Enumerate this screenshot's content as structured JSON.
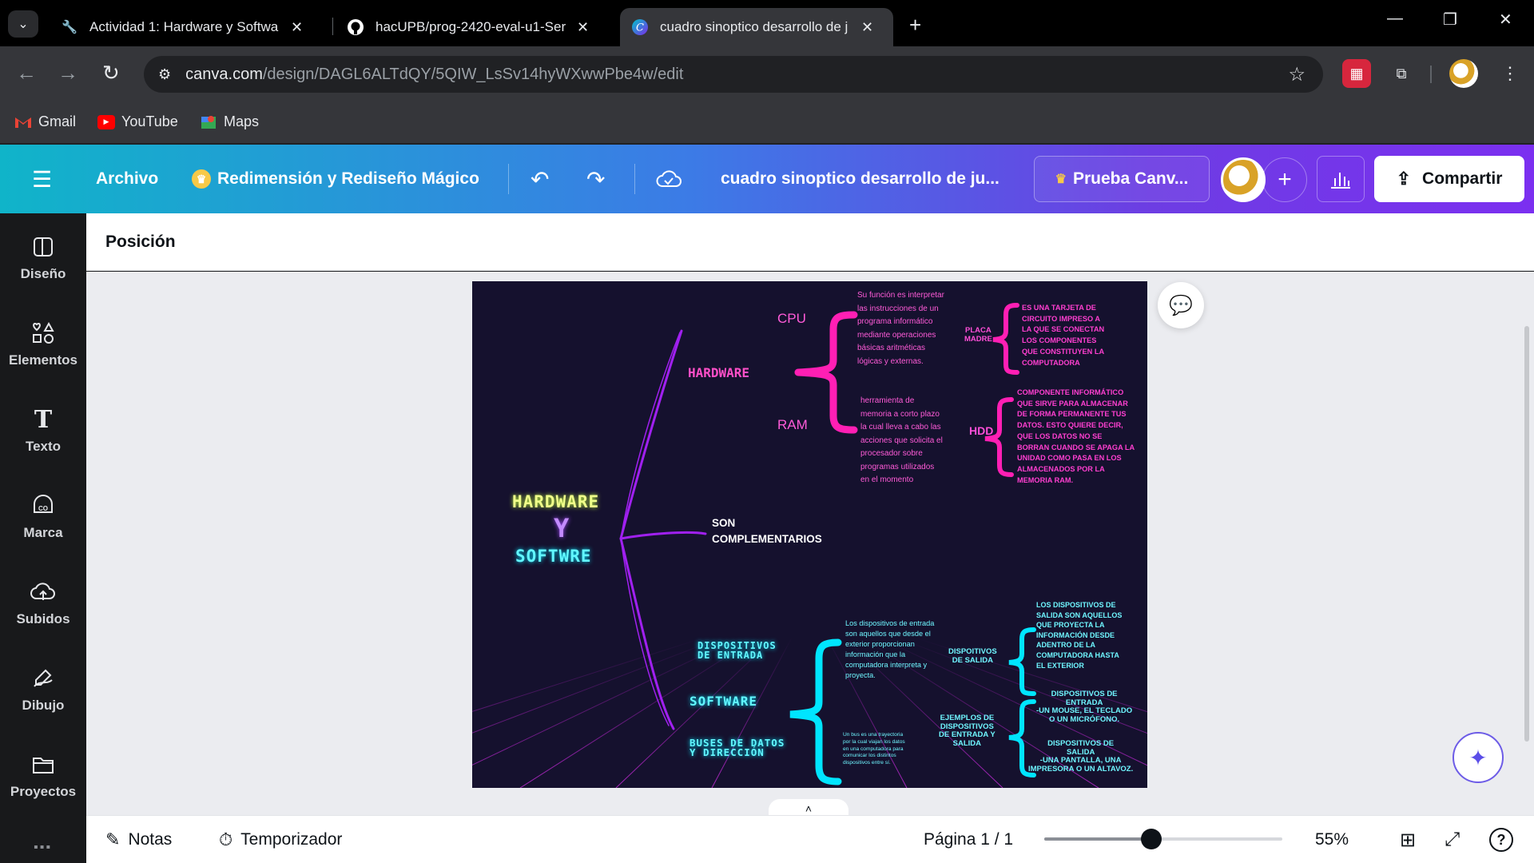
{
  "browser": {
    "tabs": [
      {
        "title": "Actividad 1: Hardware y Softwa",
        "favicon": "wrench-icon"
      },
      {
        "title": "hacUPB/prog-2420-eval-u1-Ser",
        "favicon": "github-icon"
      },
      {
        "title": "cuadro sinoptico desarrollo de j",
        "favicon": "canva-icon",
        "active": true
      }
    ],
    "url_host": "canva.com",
    "url_path": "/design/DAGL6ALTdQY/5QIW_LsSv14hyWXwwPbe4w/edit",
    "bookmarks": [
      {
        "label": "Gmail",
        "icon": "gmail-icon"
      },
      {
        "label": "YouTube",
        "icon": "youtube-icon"
      },
      {
        "label": "Maps",
        "icon": "maps-icon"
      }
    ]
  },
  "canva": {
    "header": {
      "archivo": "Archivo",
      "magic_resize": "Redimensión y Rediseño Mágico",
      "doc_title": "cuadro sinoptico desarrollo de ju...",
      "trial": "Prueba Canv...",
      "share": "Compartir"
    },
    "sidebar": [
      {
        "label": "Diseño",
        "icon": "layout-icon"
      },
      {
        "label": "Elementos",
        "icon": "shapes-icon"
      },
      {
        "label": "Texto",
        "icon": "text-icon"
      },
      {
        "label": "Marca",
        "icon": "brand-icon"
      },
      {
        "label": "Subidos",
        "icon": "cloud-upload-icon"
      },
      {
        "label": "Dibujo",
        "icon": "draw-icon"
      },
      {
        "label": "Proyectos",
        "icon": "folder-icon"
      }
    ],
    "context_bar": {
      "position_label": "Posición"
    },
    "footer": {
      "notes": "Notas",
      "timer": "Temporizador",
      "page": "Página 1 / 1",
      "zoom": "55%",
      "zoom_fraction": 0.55
    }
  },
  "design": {
    "title_line1": "HARDWARE",
    "title_line2": "Y",
    "title_line3": "SOFTWRE",
    "hardware": "HARDWARE",
    "cpu": "CPU",
    "ram": "RAM",
    "cpu_desc": "Su función es interpretar\nlas instrucciones de un\nprograma informático\nmediante operaciones\nbásicas aritméticas\nlógicas y externas.",
    "ram_desc": " herramienta de\nmemoria a corto plazo\nla cual lleva a cabo las\nacciones que solicita el\nprocesador sobre\nprogramas utilizados\nen el momento",
    "placa_madre": "PLACA\nMADRE",
    "placa_desc": "ES UNA TARJETA DE\nCIRCUITO IMPRESO A\nLA QUE SE CONECTAN\nLOS COMPONENTES\nQUE CONSTITUYEN LA\nCOMPUTADORA",
    "hdd": "HDD",
    "hdd_desc": "COMPONENTE INFORMÁTICO\nQUE SIRVE PARA ALMACENAR\nDE FORMA PERMANENTE TUS\nDATOS. ESTO QUIERE DECIR,\nQUE LOS DATOS NO SE\nBORRAN CUANDO SE APAGA LA\nUNIDAD COMO PASA EN LOS\nALMACENADOS POR LA\nMEMORIA RAM.",
    "son_complementarios": "SON\nCOMPLEMENTARIOS",
    "dispositivos_entrada": "DISPOSITIVOS\nDE ENTRADA",
    "software": "SOFTWARE",
    "buses": "BUSES DE DATOS\nY DIRECCIÓN",
    "entrada_desc": "Los dispositivos de entrada\nson aquellos que desde el\nexterior proporcionan\ninformación que la\ncomputadora interpreta y\nproyecta.",
    "bus_desc": "Un bus es una trayectoria\npor la cual viajan los datos\nen una computadora para\ncomunicar los distintos\ndispositivos entre sí.",
    "disp_salida": "DISPOITIVOS\nDE SALIDA",
    "salida_desc": "LOS DISPOSITIVOS DE\nSALIDA SON AQUELLOS\nQUE PROYECTA LA\nINFORMACIÓN DESDE\nADENTRO DE LA\nCOMPUTADORA HASTA\nEL EXTERIOR",
    "ejemplos": "EJEMPLOS DE\nDISPOSITIVOS\nDE ENTRADA Y\nSALIDA",
    "ej_entrada": "DISPOSITIVOS DE\nENTRADA\n-UN MOUSE, EL TECLADO\nO UN MICRÓFONO.",
    "ej_salida": "DISPOSITIVOS DE\nSALIDA\n-UNA PANTALLA, UNA\nIMPRESORA O UN ALTAVOZ."
  },
  "colors": {
    "canva_gradient_start": "#10b4c9",
    "canva_gradient_end": "#7b2ff0",
    "slide_bg": "#15112e",
    "neon_pink": "#ff1fb4",
    "neon_cyan": "#00e5ff",
    "neon_purple": "#a020f0"
  }
}
